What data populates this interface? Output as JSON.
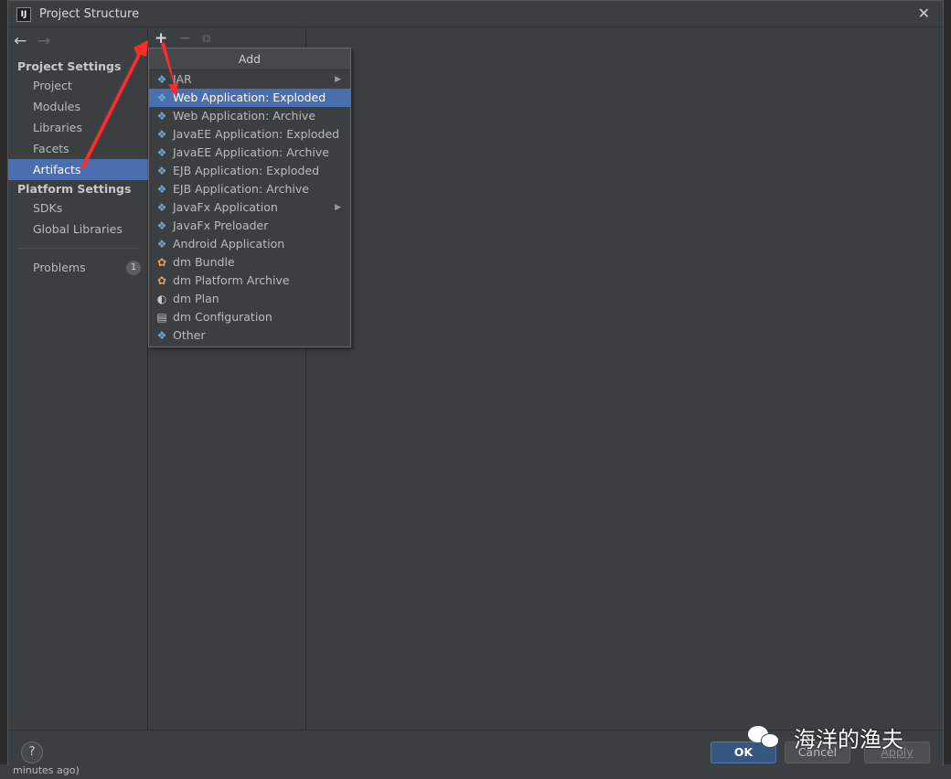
{
  "window": {
    "title": "Project Structure",
    "logo_text": "IJ",
    "close_glyph": "✕"
  },
  "nav": {
    "back_glyph": "←",
    "forward_glyph": "→"
  },
  "sidebar": {
    "project_settings_header": "Project Settings",
    "project_items": [
      "Project",
      "Modules",
      "Libraries",
      "Facets",
      "Artifacts"
    ],
    "selected_item": "Artifacts",
    "platform_settings_header": "Platform Settings",
    "platform_items": [
      "SDKs",
      "Global Libraries"
    ],
    "problems_label": "Problems",
    "problems_count": "1"
  },
  "toolbar": {
    "add_glyph": "+",
    "remove_glyph": "−",
    "copy_glyph": "⧉"
  },
  "popup": {
    "title": "Add",
    "items": [
      {
        "label": "JAR",
        "icon": "diamond-icon",
        "submenu": true
      },
      {
        "label": "Web Application: Exploded",
        "icon": "web-diamond-icon",
        "selected": true
      },
      {
        "label": "Web Application: Archive",
        "icon": "web-diamond-icon"
      },
      {
        "label": "JavaEE Application: Exploded",
        "icon": "javaee-diamond-icon"
      },
      {
        "label": "JavaEE Application: Archive",
        "icon": "javaee-diamond-icon"
      },
      {
        "label": "EJB Application: Exploded",
        "icon": "ejb-diamond-icon"
      },
      {
        "label": "EJB Application: Archive",
        "icon": "ejb-diamond-icon"
      },
      {
        "label": "JavaFx Application",
        "icon": "diamond-icon",
        "submenu": true
      },
      {
        "label": "JavaFx Preloader",
        "icon": "diamond-icon"
      },
      {
        "label": "Android Application",
        "icon": "diamond-icon"
      },
      {
        "label": "dm Bundle",
        "icon": "bundle-icon"
      },
      {
        "label": "dm Platform Archive",
        "icon": "bundle-icon"
      },
      {
        "label": "dm Plan",
        "icon": "plan-icon"
      },
      {
        "label": "dm Configuration",
        "icon": "config-icon"
      },
      {
        "label": "Other",
        "icon": "diamond-icon"
      }
    ]
  },
  "footer": {
    "help_glyph": "?",
    "ok_label": "OK",
    "cancel_label": "Cancel",
    "apply_label": "Apply"
  },
  "watermark": {
    "text": "海洋的渔夫"
  },
  "background_ide": {
    "bottom_text": "minutes ago)"
  },
  "colors": {
    "selection": "#4b6eaf",
    "annotation_arrow": "#ff2a2a",
    "ok_button": "#365880"
  }
}
